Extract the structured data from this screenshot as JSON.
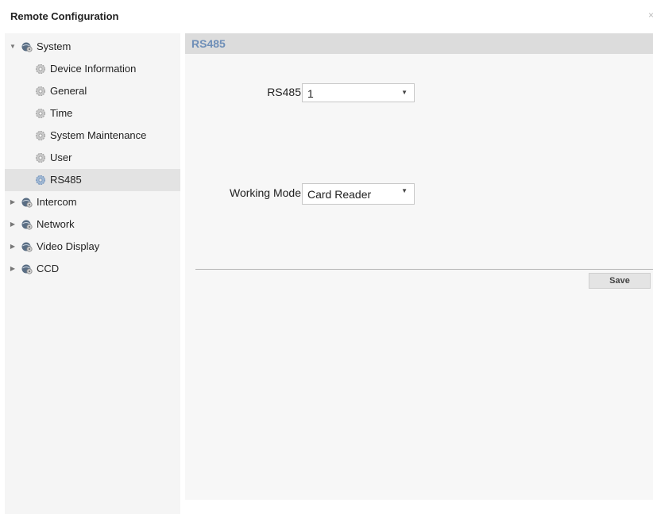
{
  "window": {
    "title": "Remote Configuration",
    "close_glyph": "×"
  },
  "sidebar": {
    "items": [
      {
        "label": "System",
        "level": 0,
        "expanded": true,
        "icon": "globe-gear-icon"
      },
      {
        "label": "Device Information",
        "level": 1,
        "icon": "gear-icon"
      },
      {
        "label": "General",
        "level": 1,
        "icon": "gear-icon"
      },
      {
        "label": "Time",
        "level": 1,
        "icon": "gear-icon"
      },
      {
        "label": "System Maintenance",
        "level": 1,
        "icon": "gear-icon"
      },
      {
        "label": "User",
        "level": 1,
        "icon": "gear-icon"
      },
      {
        "label": "RS485",
        "level": 1,
        "selected": true,
        "icon": "gear-icon"
      },
      {
        "label": "Intercom",
        "level": 0,
        "expanded": false,
        "icon": "globe-gear-icon"
      },
      {
        "label": "Network",
        "level": 0,
        "expanded": false,
        "icon": "globe-gear-icon"
      },
      {
        "label": "Video Display",
        "level": 0,
        "expanded": false,
        "icon": "globe-gear-icon"
      },
      {
        "label": "CCD",
        "level": 0,
        "expanded": false,
        "icon": "globe-gear-icon"
      }
    ]
  },
  "main": {
    "section_title": "RS485",
    "rs485": {
      "label": "RS485",
      "value": "1"
    },
    "working_mode": {
      "label": "Working Mode",
      "value": "Card Reader"
    },
    "save_label": "Save"
  },
  "colors": {
    "accent_title": "#6f8fb8",
    "sidebar_bg": "#f5f5f5",
    "selected_bg": "#e3e3e3",
    "header_bg": "#dcdcdc"
  }
}
